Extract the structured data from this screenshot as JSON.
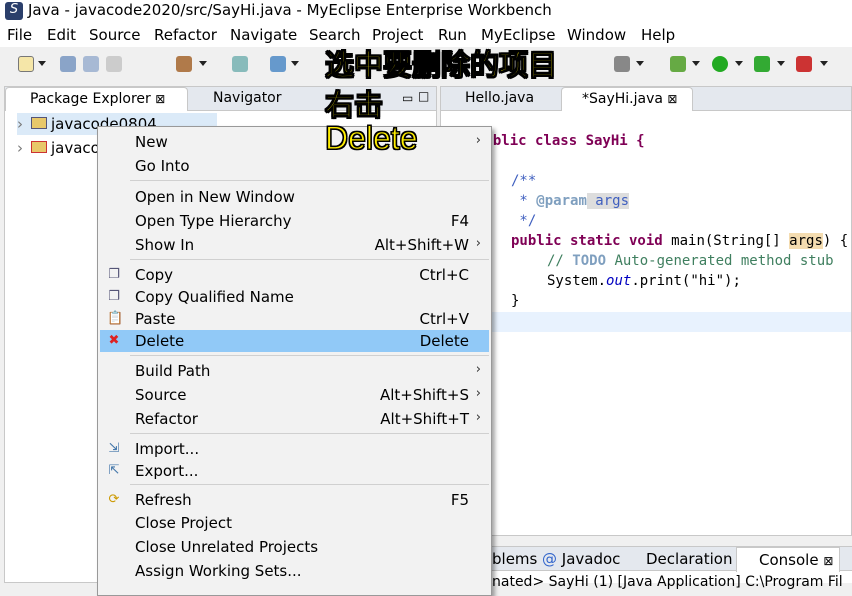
{
  "window": {
    "title": "Java - javacode2020/src/SayHi.java - MyEclipse Enterprise Workbench"
  },
  "menu": [
    "File",
    "Edit",
    "Source",
    "Refactor",
    "Navigate",
    "Search",
    "Project",
    "Run",
    "MyEclipse",
    "Window",
    "Help"
  ],
  "left_tabs": [
    {
      "label": "Package Explorer",
      "active": true
    },
    {
      "label": "Navigator",
      "active": false
    }
  ],
  "tree": [
    "javacode0804",
    "javaco"
  ],
  "editor_tabs": [
    {
      "label": "Hello.java",
      "active": false
    },
    {
      "label": "*SayHi.java",
      "active": true
    }
  ],
  "code": {
    "l1": "public class SayHi {",
    "l2": "/**",
    "l3a": " * ",
    "l3b": "@param",
    "l3c": " args",
    "l4": " */",
    "l5a": "public static void ",
    "l5b": "main(String[] ",
    "l5c": "args",
    "l5d": ") {",
    "l6a": "// ",
    "l6b": "TODO",
    "l6c": " Auto-generated method stub",
    "l7a": "System.",
    "l7b": "out",
    "l7c": ".print(\"hi\");",
    "l8": "}"
  },
  "context_menu": [
    {
      "label": "New",
      "shortcut": "",
      "submenu": true,
      "icon": ""
    },
    {
      "label": "Go Into",
      "shortcut": "",
      "icon": ""
    },
    {
      "label": "Open in New Window",
      "shortcut": "",
      "icon": ""
    },
    {
      "label": "Open Type Hierarchy",
      "shortcut": "F4",
      "icon": ""
    },
    {
      "label": "Show In",
      "shortcut": "Alt+Shift+W",
      "submenu": true,
      "icon": ""
    },
    {
      "label": "Copy",
      "shortcut": "Ctrl+C",
      "icon": "copy-icon"
    },
    {
      "label": "Copy Qualified Name",
      "shortcut": "",
      "icon": "copy-icon"
    },
    {
      "label": "Paste",
      "shortcut": "Ctrl+V",
      "icon": "paste-icon"
    },
    {
      "label": "Delete",
      "shortcut": "Delete",
      "icon": "delete-icon",
      "highlighted": true
    },
    {
      "label": "Build Path",
      "shortcut": "",
      "submenu": true,
      "icon": ""
    },
    {
      "label": "Source",
      "shortcut": "Alt+Shift+S",
      "submenu": true,
      "icon": ""
    },
    {
      "label": "Refactor",
      "shortcut": "Alt+Shift+T",
      "submenu": true,
      "icon": ""
    },
    {
      "label": "Import...",
      "shortcut": "",
      "icon": "import-icon"
    },
    {
      "label": "Export...",
      "shortcut": "",
      "icon": "export-icon"
    },
    {
      "label": "Refresh",
      "shortcut": "F5",
      "icon": "refresh-icon"
    },
    {
      "label": "Close Project",
      "shortcut": "",
      "icon": ""
    },
    {
      "label": "Close Unrelated Projects",
      "shortcut": "",
      "icon": ""
    },
    {
      "label": "Assign Working Sets...",
      "shortcut": "",
      "icon": ""
    }
  ],
  "bottom_tabs": [
    "blems",
    "Javadoc",
    "Declaration",
    "Console"
  ],
  "console_text": "nated> SayHi (1) [Java Application] C:\\Program Fil",
  "annotation": {
    "line1": "选中要删除的项目",
    "line2": "右击",
    "line3": "Delete"
  },
  "colors": {
    "highlight": "#91c9f7",
    "annotation": "#ffee00",
    "keyword": "#7f0055"
  }
}
